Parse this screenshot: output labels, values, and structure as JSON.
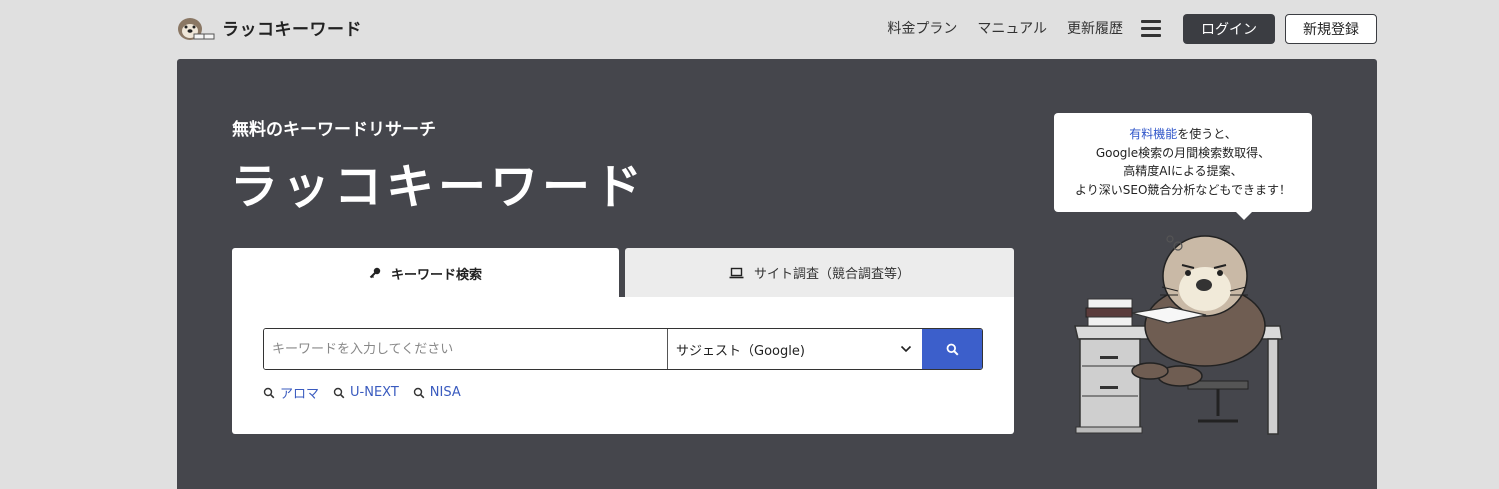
{
  "header": {
    "logo_text": "ラッコキーワード",
    "nav": [
      "料金プラン",
      "マニュアル",
      "更新履歴"
    ],
    "login_label": "ログイン",
    "register_label": "新規登録",
    "menu_icon": "hamburger-icon"
  },
  "hero": {
    "subtitle": "無料のキーワードリサーチ",
    "title": "ラッコキーワード",
    "tabs": [
      {
        "label": "キーワード検索",
        "icon": "key-icon",
        "active": true
      },
      {
        "label": "サイト調査（競合調査等）",
        "icon": "laptop-icon",
        "active": false
      }
    ],
    "search": {
      "placeholder": "キーワードを入力してください",
      "value": "",
      "select_value": "サジェスト（Google)"
    },
    "suggestions": [
      "アロマ",
      "U-NEXT",
      "NISA"
    ]
  },
  "bubble": {
    "highlight": "有料機能",
    "line1_rest": "を使うと、",
    "line2": "Google検索の月間検索数取得、",
    "line3": "高精度AIによる提案、",
    "line4": "より深いSEO競合分析などもできます！"
  },
  "colors": {
    "hero_bg": "#45464c",
    "page_bg": "#e0e0e0",
    "accent_blue": "#3c5fcb",
    "login_bg": "#3b3d42"
  }
}
